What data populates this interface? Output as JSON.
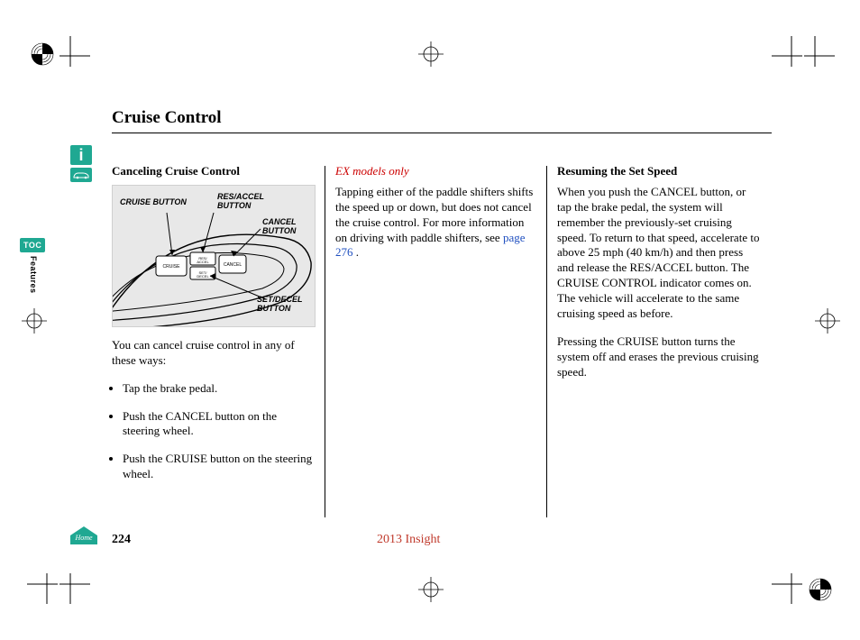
{
  "title": "Cruise Control",
  "sidebar": {
    "toc": "TOC",
    "tab": "Features"
  },
  "col1": {
    "heading": "Canceling Cruise Control",
    "fig": {
      "cruise": "CRUISE BUTTON",
      "res": "RES/ACCEL BUTTON",
      "cancel": "CANCEL BUTTON",
      "set": "SET/DECEL BUTTON",
      "btn1": "CRUISE",
      "btn2": "RES/ACCEL",
      "btn3": "CANCEL",
      "btn4": "SET/DECEL"
    },
    "intro": "You can cancel cruise control in any of these ways:",
    "bullets": [
      "Tap the brake pedal.",
      "Push the CANCEL button on the steering wheel.",
      "Push the CRUISE button on the steering wheel."
    ]
  },
  "col2": {
    "heading": "EX models only",
    "body_a": "Tapping either of the paddle shifters shifts the speed up or down, but does not cancel the cruise control. For more information on driving with paddle shifters, see ",
    "link": "page 276",
    "body_b": " ."
  },
  "col3": {
    "heading": "Resuming the Set Speed",
    "p1": "When you push the CANCEL button, or tap the brake pedal, the system will remember the previously-set cruising speed. To return to that speed, accelerate to above 25 mph (40 km/h) and then press and release the RES/ACCEL button. The CRUISE CONTROL indicator comes on. The vehicle will accelerate to the same cruising speed as before.",
    "p2": "Pressing the CRUISE button turns the system off and erases the previous cruising speed."
  },
  "footer": {
    "page": "224",
    "model": "2013 Insight"
  }
}
